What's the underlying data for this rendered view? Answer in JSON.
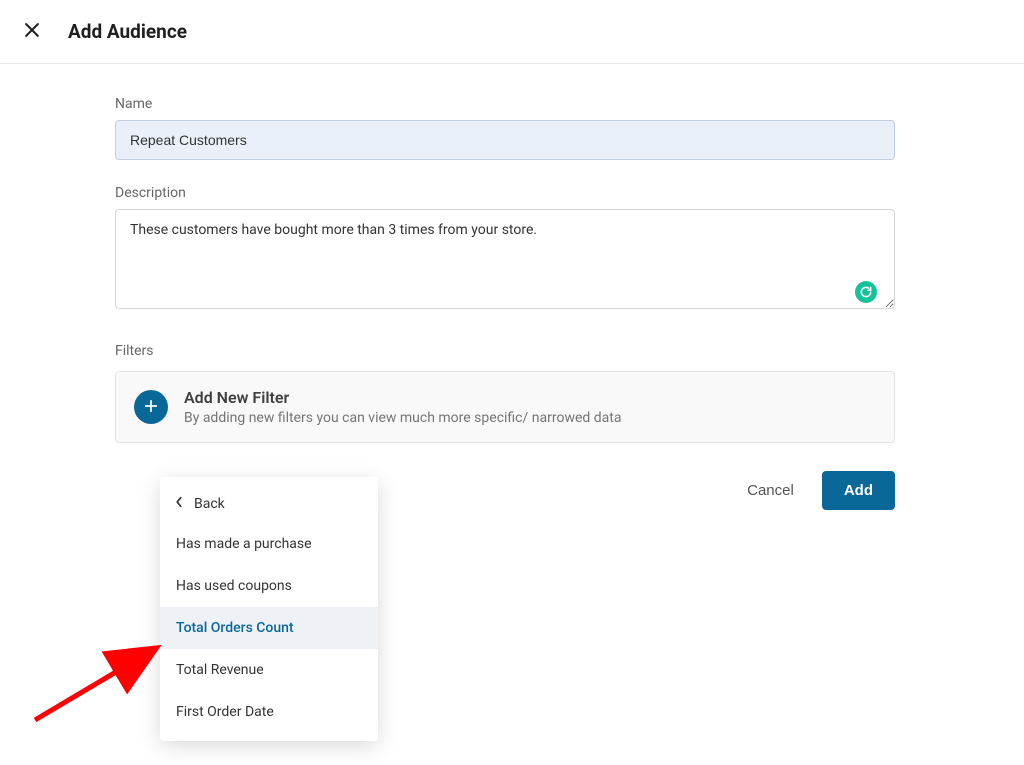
{
  "header": {
    "title": "Add Audience"
  },
  "name": {
    "label": "Name",
    "value": "Repeat Customers"
  },
  "description": {
    "label": "Description",
    "value": "These customers have bought more than 3 times from your store."
  },
  "filters": {
    "section_label": "Filters",
    "add_title": "Add New Filter",
    "add_subtitle": "By adding new filters you can view much more specific/ narrowed data"
  },
  "dropdown": {
    "back_label": "Back",
    "items": [
      {
        "label": "Has made a purchase",
        "active": false
      },
      {
        "label": "Has used coupons",
        "active": false
      },
      {
        "label": "Total Orders Count",
        "active": true
      },
      {
        "label": "Total Revenue",
        "active": false
      },
      {
        "label": "First Order Date",
        "active": false
      }
    ]
  },
  "actions": {
    "cancel": "Cancel",
    "add": "Add"
  }
}
